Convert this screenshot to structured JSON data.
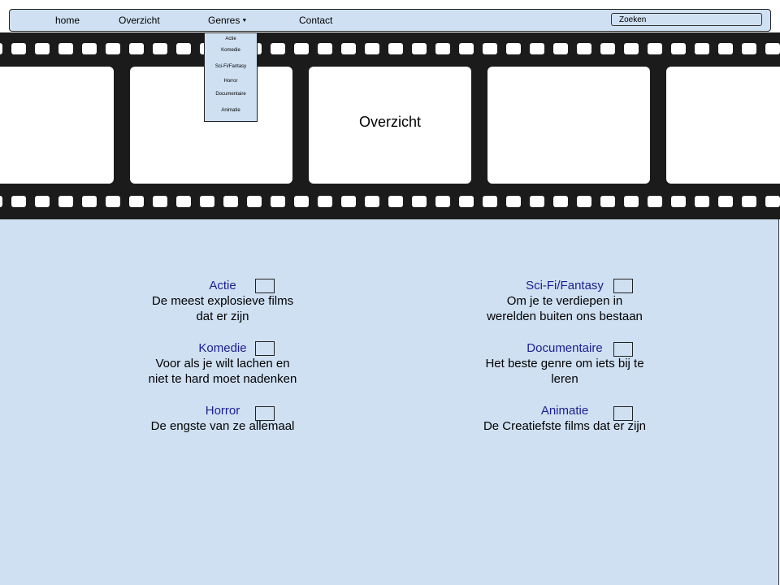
{
  "nav": {
    "home": "home",
    "overzicht": "Overzicht",
    "genres": "Genres",
    "contact": "Contact",
    "search_placeholder": "Zoeken"
  },
  "dropdown": {
    "items": [
      "Actie",
      "Komedie",
      "Sci-Fi/Fantasy",
      "Horror",
      "Documentaire",
      "Animatie"
    ]
  },
  "banner": {
    "title": "Overzicht"
  },
  "genres": [
    {
      "name": "Actie",
      "desc1": "De meest explosieve films",
      "desc2": "dat er zijn"
    },
    {
      "name": "Komedie",
      "desc1": "Voor als je wilt lachen en",
      "desc2": "niet te hard moet nadenken"
    },
    {
      "name": "Horror",
      "desc1": "De engste van ze allemaal",
      "desc2": ""
    },
    {
      "name": "Sci-Fi/Fantasy",
      "desc1": "Om je te verdiepen in",
      "desc2": "werelden buiten ons bestaan"
    },
    {
      "name": "Documentaire",
      "desc1": "Het beste genre om iets bij te",
      "desc2": "leren"
    },
    {
      "name": "Animatie",
      "desc1": "De Creatiefste films dat er zijn",
      "desc2": ""
    }
  ],
  "colors": {
    "page_background": "#cfe0f2",
    "film_strip": "#1b1b1b",
    "genre_link": "#1f1d8c"
  }
}
